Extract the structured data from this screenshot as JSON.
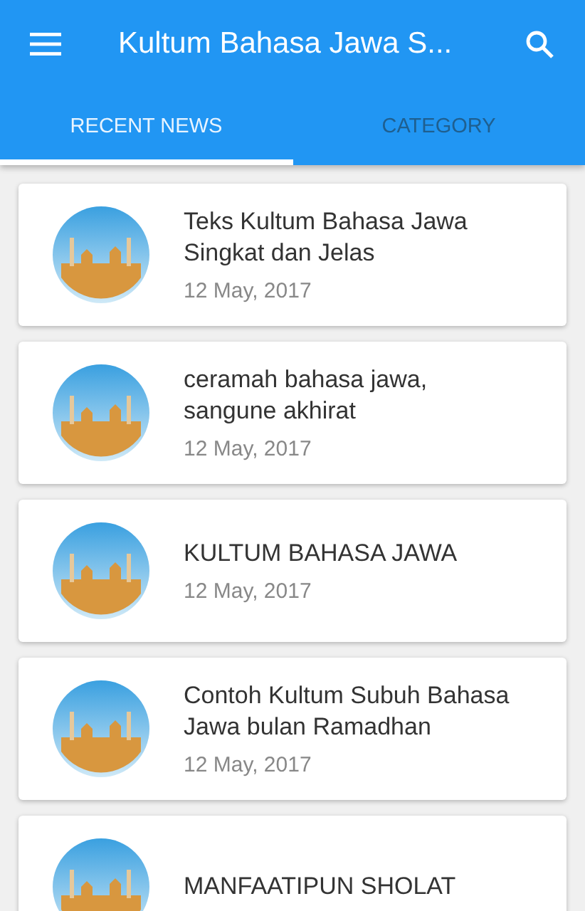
{
  "app_bar": {
    "title": "Kultum Bahasa Jawa S..."
  },
  "tabs": [
    {
      "label": "RECENT NEWS",
      "selected": true
    },
    {
      "label": "CATEGORY",
      "selected": false
    }
  ],
  "articles": [
    {
      "title": "Teks Kultum Bahasa Jawa Singkat dan Jelas",
      "date": "12 May, 2017"
    },
    {
      "title": "ceramah bahasa jawa, sangune akhirat",
      "date": "12 May, 2017"
    },
    {
      "title": "KULTUM BAHASA JAWA",
      "date": "12 May, 2017"
    },
    {
      "title": "Contoh Kultum Subuh Bahasa Jawa bulan Ramadhan",
      "date": "12 May, 2017"
    },
    {
      "title": "MANFAATIPUN SHOLAT"
    }
  ]
}
